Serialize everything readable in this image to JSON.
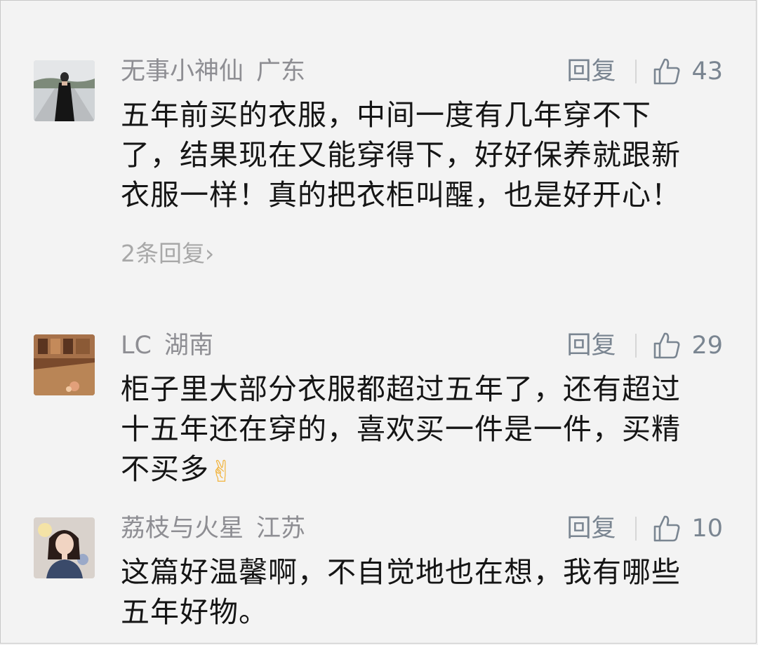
{
  "comments": [
    {
      "name": "无事小神仙",
      "location": "广东",
      "reply_label": "回复",
      "likes": "43",
      "lines": [
        "五年前买的衣服，中间一度有几年穿不下",
        "了，结果现在又能穿得下，好好保养就跟新",
        "衣服一样！真的把衣柜叫醒，也是好开心！"
      ],
      "sub_replies": "2条回复",
      "sub_chevron": "›"
    },
    {
      "name": "LC",
      "location": "湖南",
      "reply_label": "回复",
      "likes": "29",
      "lines": [
        "柜子里大部分衣服都超过五年了，还有超过",
        "十五年还在穿的，喜欢买一件是一件，买精",
        "不买多"
      ],
      "emoji": "✌"
    },
    {
      "name": "荔枝与火星",
      "location": "江苏",
      "reply_label": "回复",
      "likes": "10",
      "lines": [
        "这篇好温馨啊，不自觉地也在想，我有哪些",
        "五年好物。"
      ]
    }
  ],
  "colors": {
    "background": "#f3f3f3",
    "meta": "#8e8e93",
    "action": "#7a8591",
    "text": "#151515"
  },
  "icons": [
    "thumbs-up-icon",
    "chevron-right-icon",
    "victory-hand-icon"
  ]
}
